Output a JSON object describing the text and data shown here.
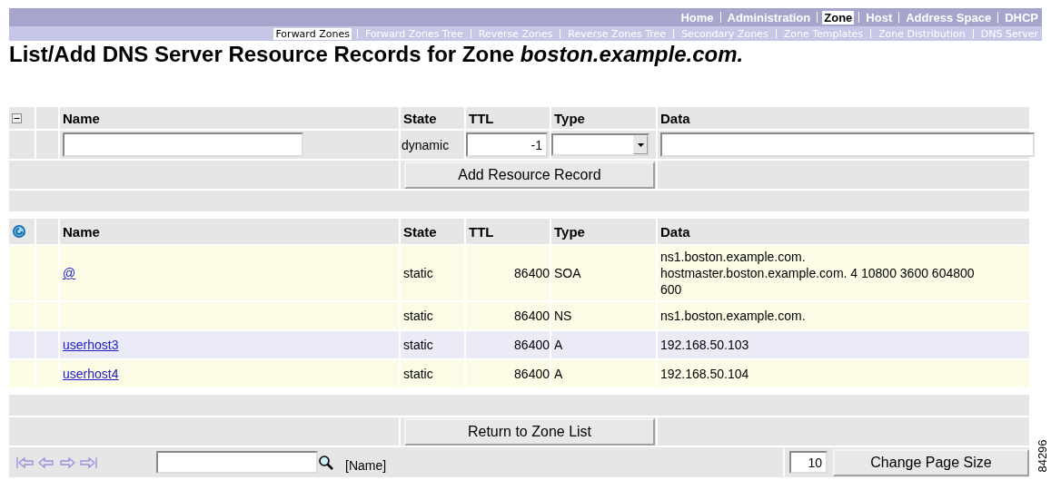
{
  "top_nav": [
    {
      "label": "Home",
      "selected": false
    },
    {
      "label": "Administration",
      "selected": false
    },
    {
      "label": "Zone",
      "selected": true
    },
    {
      "label": "Host",
      "selected": false
    },
    {
      "label": "Address Space",
      "selected": false
    },
    {
      "label": "DHCP",
      "selected": false
    }
  ],
  "sub_nav": [
    {
      "label": "Forward Zones",
      "selected": true
    },
    {
      "label": "Forward Zones Tree",
      "selected": false
    },
    {
      "label": "Reverse Zones",
      "selected": false
    },
    {
      "label": "Reverse Zones Tree",
      "selected": false
    },
    {
      "label": "Secondary Zones",
      "selected": false
    },
    {
      "label": "Zone Templates",
      "selected": false
    },
    {
      "label": "Zone Distribution",
      "selected": false
    },
    {
      "label": "DNS Server",
      "selected": false
    }
  ],
  "title": "List/Add DNS Server Resource Records for Zone *boston.example.com.*",
  "add_form": {
    "columns": [
      "Name",
      "State",
      "TTL",
      "Type",
      "Data"
    ],
    "state": "dynamic",
    "ttl": "-1",
    "button": "Add Resource Record"
  },
  "records": {
    "columns": [
      "Name",
      "State",
      "TTL",
      "Type",
      "Data"
    ],
    "rows": [
      {
        "name": "@",
        "state": "static",
        "ttl": "86400",
        "type": "SOA",
        "data": "ns1.boston.example.com. hostmaster.boston.example.com. 4 10800 3600 604800 600",
        "highlight": false
      },
      {
        "state": "static",
        "ttl": "86400",
        "type": "NS",
        "data": "ns1.boston.example.com.",
        "highlight": false
      },
      {
        "name": "userhost3",
        "state": "static",
        "ttl": "86400",
        "type": "A",
        "data": "192.168.50.103",
        "highlight": true
      },
      {
        "name": "userhost4",
        "state": "static",
        "ttl": "86400",
        "type": "A",
        "data": "192.168.50.104",
        "highlight": false
      }
    ]
  },
  "return_button": "Return to Zone List",
  "footer": {
    "filter_label": "[Name]",
    "page_size": "10",
    "page_size_button": "Change Page Size"
  },
  "figure_number": "84296"
}
